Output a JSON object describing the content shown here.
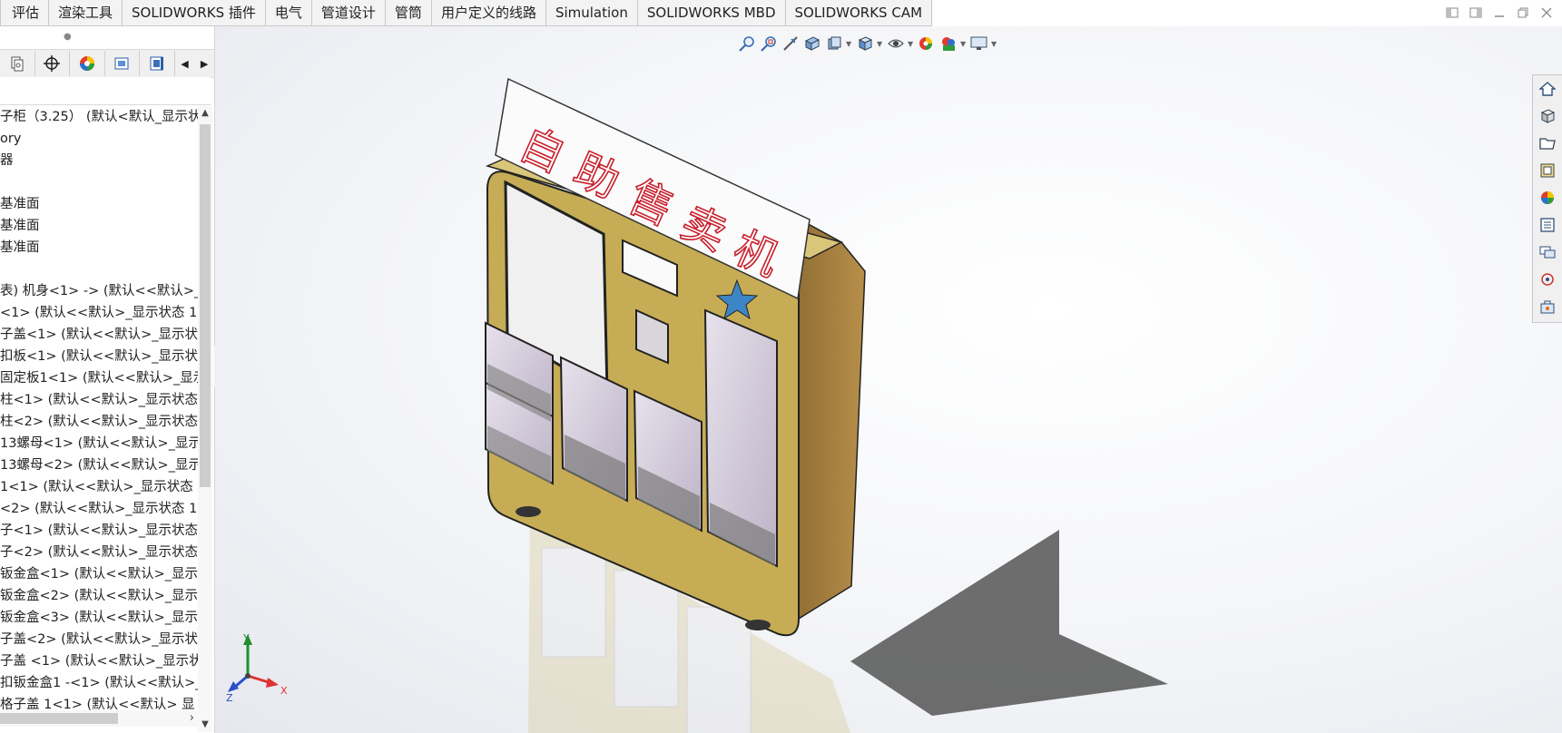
{
  "tabs": [
    "评估",
    "渲染工具",
    "SOLIDWORKS 插件",
    "电气",
    "管道设计",
    "管筒",
    "用户定义的线路",
    "Simulation",
    "SOLIDWORKS MBD",
    "SOLIDWORKS CAM"
  ],
  "window_controls": [
    "tile-left-icon",
    "tile-right-icon",
    "minimize-icon",
    "restore-icon",
    "close-icon"
  ],
  "feature_manager": {
    "tool_icons": [
      "configuration-manager-icon",
      "dimxpert-icon",
      "display-manager-icon",
      "cam-feature-icon",
      "cam-operation-icon"
    ],
    "tree": [
      "子柜（3.25） (默认<默认_显示状",
      "ory",
      "器",
      "",
      "基准面",
      "基准面",
      "基准面",
      "",
      "表) 机身<1> -> (默认<<默认>_显",
      "<1> (默认<<默认>_显示状态 1",
      "子盖<1> (默认<<默认>_显示状",
      "扣板<1> (默认<<默认>_显示状",
      "固定板1<1> (默认<<默认>_显示",
      "柱<1> (默认<<默认>_显示状态",
      "柱<2> (默认<<默认>_显示状态",
      "13螺母<1> (默认<<默认>_显示",
      "13螺母<2> (默认<<默认>_显示",
      "1<1> (默认<<默认>_显示状态",
      "<2> (默认<<默认>_显示状态 1",
      "子<1> (默认<<默认>_显示状态",
      "子<2> (默认<<默认>_显示状态",
      "钣金盒<1> (默认<<默认>_显示",
      "钣金盒<2> (默认<<默认>_显示",
      "钣金盒<3> (默认<<默认>_显示",
      "子盖<2> (默认<<默认>_显示状",
      "子盖 <1> (默认<<默认>_显示状",
      "扣钣金盒1 -<1> (默认<<默认>_",
      "格子盖 1<1> (默认<<默认> 显"
    ]
  },
  "heads_up_toolbar": [
    "zoom-to-fit-icon",
    "zoom-to-area-icon",
    "previous-view-icon",
    "section-view-icon",
    "dynamic-annotation-icon",
    "view-orientation-icon",
    "display-style-icon",
    "hide-show-items-icon",
    "edit-appearance-icon",
    "apply-scene-icon",
    "view-settings-icon"
  ],
  "task_pane": [
    "home-icon",
    "design-library-icon",
    "file-explorer-icon",
    "view-palette-icon",
    "appearances-icon",
    "custom-properties-icon",
    "forum-icon",
    "solidworks-resources-icon",
    "toolbox-icon"
  ],
  "model": {
    "sign_text": [
      "自",
      "助",
      "售",
      "卖",
      "机"
    ],
    "body_color": "#c6ad55",
    "side_color": "#b08a44",
    "sign_text_color": "#c81e2b",
    "star_color": "#3d86c6"
  },
  "triad": {
    "x": "X",
    "y": "Y",
    "z": "Z"
  }
}
